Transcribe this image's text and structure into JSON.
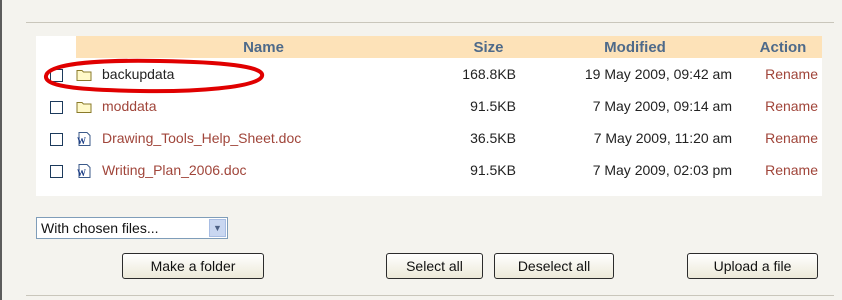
{
  "table": {
    "headers": {
      "name": "Name",
      "size": "Size",
      "modified": "Modified",
      "action": "Action"
    },
    "rows": [
      {
        "name": "backupdata",
        "type": "folder",
        "size": "168.8KB",
        "modified": "19 May 2009, 09:42 am",
        "action": "Rename"
      },
      {
        "name": "moddata",
        "type": "folder",
        "size": "91.5KB",
        "modified": "7 May 2009, 09:14 am",
        "action": "Rename"
      },
      {
        "name": "Drawing_Tools_Help_Sheet.doc",
        "type": "word-document",
        "size": "36.5KB",
        "modified": "7 May 2009, 11:20 am",
        "action": "Rename"
      },
      {
        "name": "Writing_Plan_2006.doc",
        "type": "word-document",
        "size": "91.5KB",
        "modified": "7 May 2009, 02:03 pm",
        "action": "Rename"
      }
    ]
  },
  "bulk_action": {
    "selected": "With chosen files..."
  },
  "buttons": {
    "make_folder": "Make a folder",
    "select_all": "Select all",
    "deselect_all": "Deselect all",
    "upload": "Upload a file"
  },
  "colors": {
    "header_bg": "#fde2b8",
    "header_text": "#4e6a8a",
    "link": "#a0453a",
    "highlight_ellipse": "#e00000"
  },
  "icons": {
    "folder": "folder-icon",
    "document": "word-document-icon",
    "dropdown": "chevron-down-icon"
  }
}
